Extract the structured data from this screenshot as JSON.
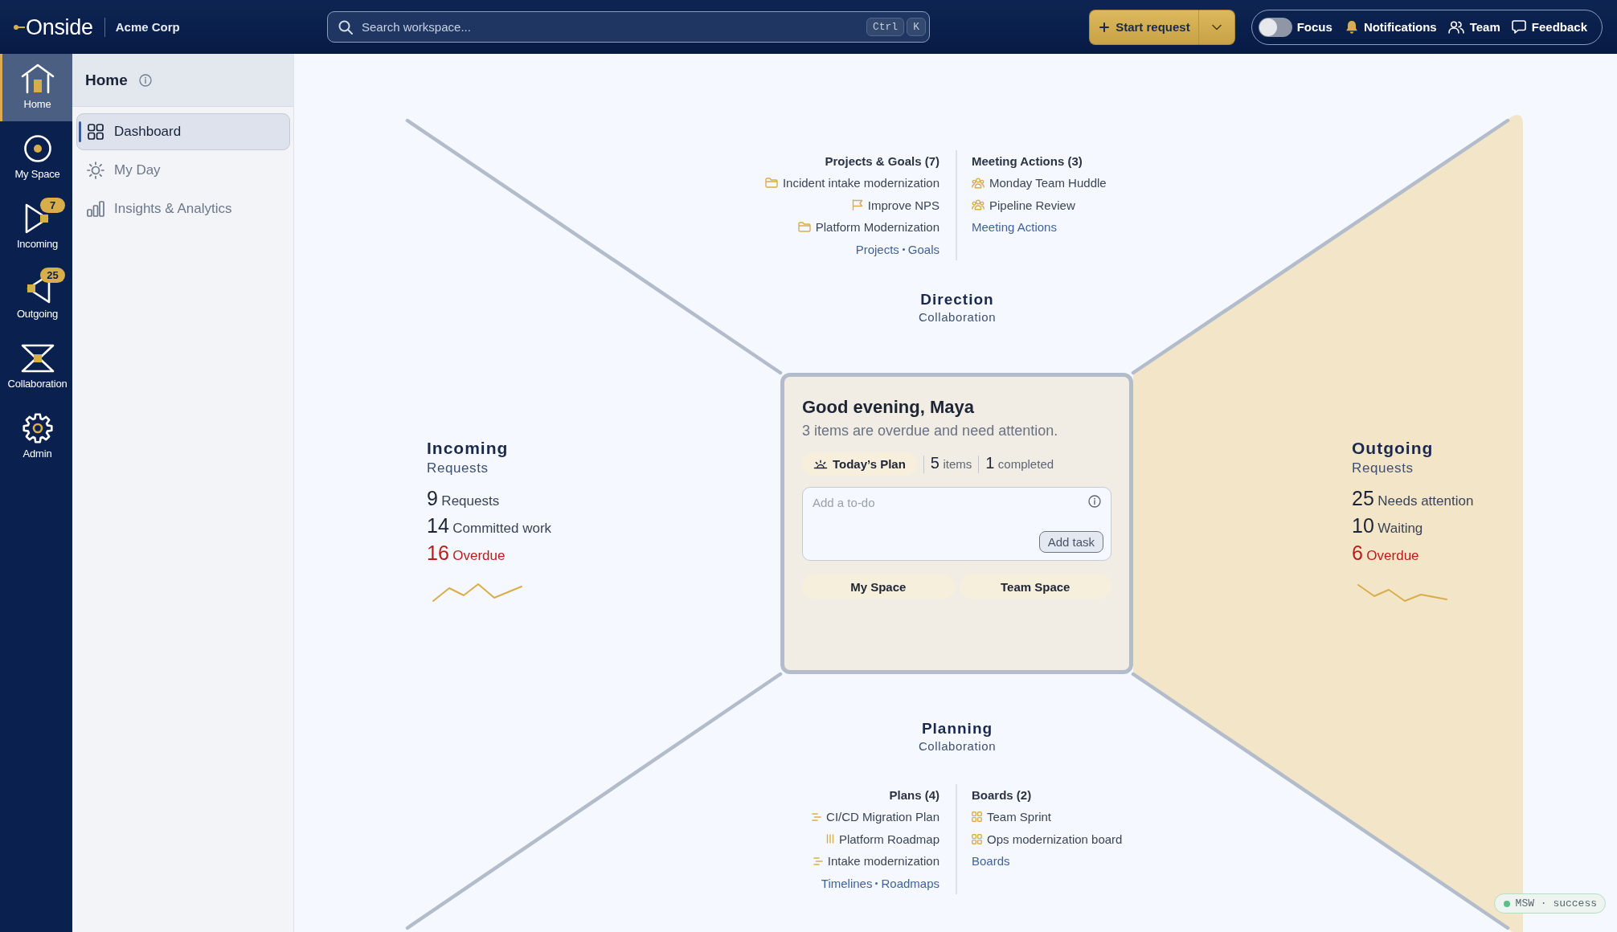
{
  "top_bar": {
    "logo": "Onside",
    "organization": "Acme Corp",
    "search": {
      "placeholder": "Search workspace...",
      "shortcut": [
        "Ctrl",
        "K"
      ]
    },
    "primary_action": {
      "label": "Start request"
    },
    "focus_toggle": {
      "label": "Focus",
      "on": false
    },
    "links": [
      {
        "kind": "notifications",
        "label": "Notifications"
      },
      {
        "kind": "team",
        "label": "Team"
      },
      {
        "kind": "feedback",
        "label": "Feedback"
      }
    ]
  },
  "nav_rail": [
    {
      "kind": "home",
      "label": "Home",
      "selected": true
    },
    {
      "kind": "my_space",
      "label": "My Space",
      "selected": false
    },
    {
      "kind": "incoming",
      "label": "Incoming",
      "selected": false,
      "badge": "7"
    },
    {
      "kind": "outgoing",
      "label": "Outgoing",
      "selected": false,
      "badge": "25"
    },
    {
      "kind": "collaboration",
      "label": "Collaboration",
      "selected": false
    },
    {
      "kind": "admin",
      "label": "Admin",
      "selected": false
    }
  ],
  "sidebar": {
    "title": "Home",
    "items": [
      {
        "kind": "dashboard",
        "label": "Dashboard",
        "selected": true
      },
      {
        "kind": "my_day",
        "label": "My Day",
        "selected": false
      },
      {
        "kind": "insights",
        "label": "Insights & Analytics",
        "selected": false
      }
    ]
  },
  "direction": {
    "title": "Direction",
    "subtitle": "Collaboration",
    "groups": [
      {
        "heading": "Projects & Goals (7)",
        "items": [
          {
            "kind": "folder",
            "label": "Incident intake modernization"
          },
          {
            "kind": "goal",
            "label": "Improve NPS"
          },
          {
            "kind": "folder",
            "label": "Platform Modernization"
          }
        ],
        "links": [
          "Projects",
          "Goals"
        ]
      },
      {
        "heading": "Meeting Actions (3)",
        "items": [
          {
            "kind": "meeting",
            "label": "Monday Team Huddle"
          },
          {
            "kind": "meeting",
            "label": "Pipeline Review"
          }
        ],
        "links": [
          "Meeting Actions"
        ]
      }
    ]
  },
  "incoming": {
    "title": "Incoming",
    "subtitle": "Requests",
    "highlighted": false,
    "stats": [
      {
        "kind": "count",
        "count": "9",
        "caption": "Requests"
      },
      {
        "kind": "count",
        "count": "14",
        "caption": "Committed work"
      },
      {
        "kind": "overdue",
        "count": "16",
        "caption": "Overdue"
      }
    ]
  },
  "welcome_card": {
    "greeting": "Good evening, Maya",
    "message": "3 items are overdue and need attention.",
    "plan": {
      "label": "Today’s Plan",
      "counts": [
        {
          "count": "5",
          "caption": "items"
        },
        {
          "count": "1",
          "caption": "completed"
        }
      ]
    },
    "todo": {
      "placeholder": "Add a to-do",
      "button": "Add task"
    },
    "spaces": [
      "My Space",
      "Team Space"
    ]
  },
  "outgoing": {
    "title": "Outgoing",
    "subtitle": "Requests",
    "highlighted": true,
    "stats": [
      {
        "kind": "count",
        "count": "25",
        "caption": "Needs attention"
      },
      {
        "kind": "count",
        "count": "10",
        "caption": "Waiting"
      },
      {
        "kind": "overdue",
        "count": "6",
        "caption": "Overdue"
      }
    ]
  },
  "planning": {
    "title": "Planning",
    "subtitle": "Collaboration",
    "groups": [
      {
        "heading": "Plans (4)",
        "items": [
          {
            "kind": "timeline",
            "label": "CI/CD Migration Plan"
          },
          {
            "kind": "roadmap",
            "label": "Platform Roadmap"
          },
          {
            "kind": "timeline",
            "label": "Intake modernization"
          }
        ],
        "links": [
          "Timelines",
          "Roadmaps"
        ]
      },
      {
        "heading": "Boards (2)",
        "items": [
          {
            "kind": "board",
            "label": "Team Sprint"
          },
          {
            "kind": "board",
            "label": "Ops modernization board"
          }
        ],
        "links": [
          "Boards"
        ]
      }
    ]
  },
  "status_badge": {
    "label": "MSW · success"
  }
}
